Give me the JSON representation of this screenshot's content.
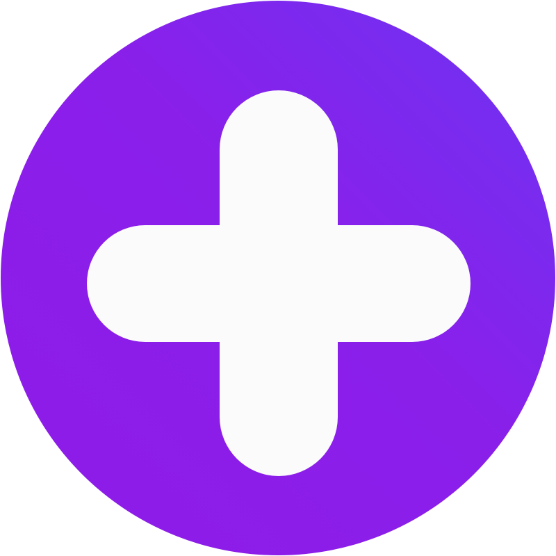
{
  "button": {
    "icon": "plus-icon",
    "action": "add"
  },
  "colors": {
    "gradient_start": "#8f1be8",
    "gradient_mid": "#8a1fea",
    "gradient_end": "#6d34f2",
    "plus": "#fbfbfb",
    "background": "#ffffff"
  }
}
